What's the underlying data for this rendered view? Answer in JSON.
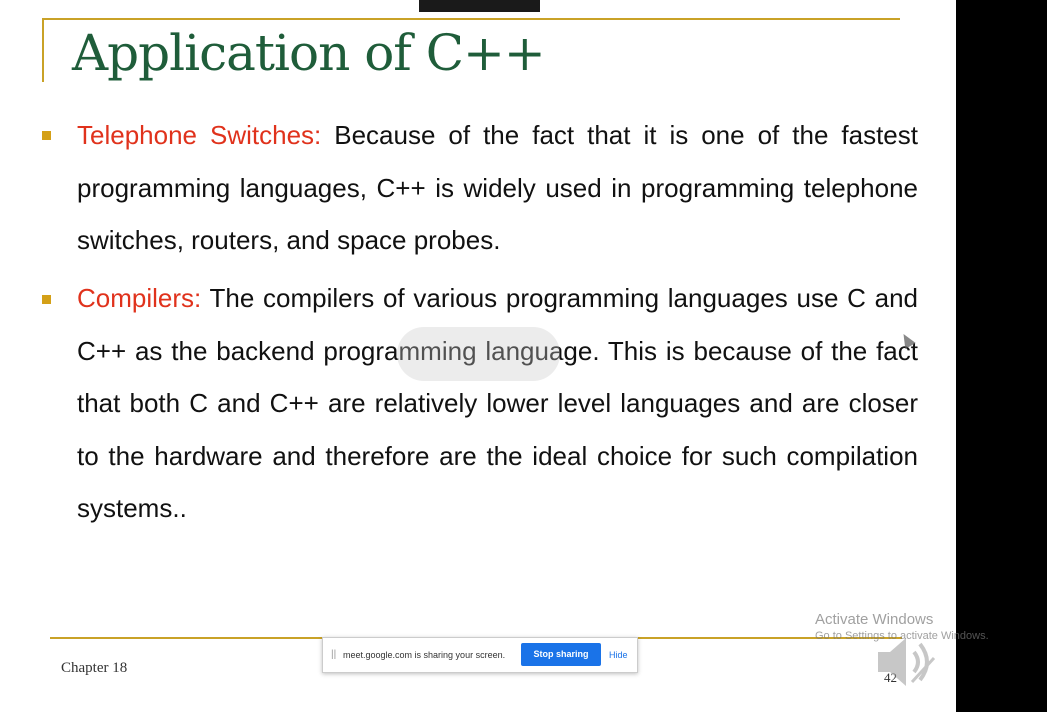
{
  "slide": {
    "title": "Application of C++",
    "bullets": [
      {
        "label": "Telephone Switches:",
        "text": " Because of the fact that it is one of the fastest programming languages, C++ is widely used in programming telephone switches, routers, and space probes."
      },
      {
        "label": "Compilers:",
        "text": " The compilers of various programming languages use C and C++ as the backend programming language. This is because of the fact that both C and C++ are relatively lower level languages and are closer to the hardware and therefore are the ideal choice for such compilation systems.."
      }
    ],
    "footer_chapter": "Chapter 18",
    "page_number": "42"
  },
  "share_bar": {
    "message": "meet.google.com is sharing your screen.",
    "stop_label": "Stop sharing",
    "hide_label": "Hide"
  },
  "watermark": {
    "line1": "Activate Windows",
    "line2": "Go to Settings to activate Windows."
  },
  "colors": {
    "accent_gold": "#c9a227",
    "bullet_gold": "#d4a017",
    "title_green": "#1f5d3a",
    "label_red": "#e0321c",
    "button_blue": "#1a73e8"
  },
  "icons": {
    "speaker": "speaker-volume-icon",
    "cursor": "mouse-cursor-icon"
  }
}
